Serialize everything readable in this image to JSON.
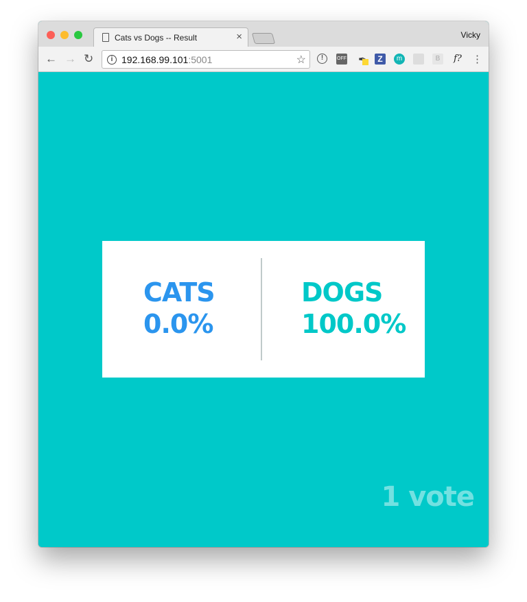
{
  "browser": {
    "tab_title": "Cats vs Dogs -- Result",
    "close_glyph": "×",
    "profile_name": "Vicky",
    "url_host": "192.168.99.101",
    "url_port": ":5001",
    "extensions": [
      "onepassword-icon",
      "off-icon",
      "eyedropper-icon",
      "zotero-icon",
      "m-icon",
      "rss-icon",
      "b-icon",
      "font-question-icon"
    ],
    "ext_labels": {
      "off": "OFF",
      "zotero": "Z",
      "m": "m",
      "b": "B",
      "f": "f?"
    }
  },
  "results": {
    "cats": {
      "label": "CATS",
      "percent": "0.0%",
      "color": "#2b95ee"
    },
    "dogs": {
      "label": "DOGS",
      "percent": "100.0%",
      "color": "#00c8c8"
    },
    "votes": "1 vote"
  },
  "colors": {
    "background": "#00c9c9"
  }
}
